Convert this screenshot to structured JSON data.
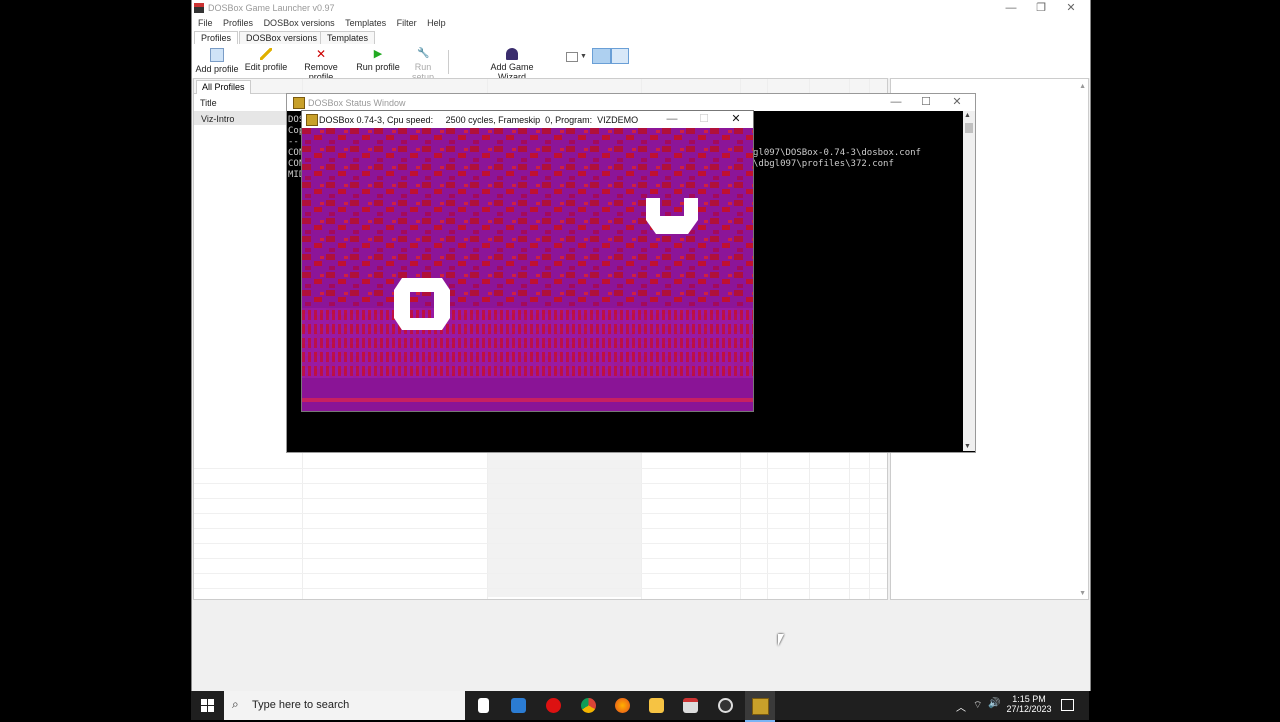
{
  "launcher": {
    "title": "DOSBox Game Launcher v0.97",
    "menu": [
      "File",
      "Profiles",
      "DOSBox versions",
      "Templates",
      "Filter",
      "Help"
    ],
    "tabs": [
      "Profiles",
      "DOSBox versions",
      "Templates"
    ],
    "toolbar": {
      "add_profile": "Add profile",
      "edit_profile": "Edit profile",
      "remove_profile": "Remove profile",
      "run_profile": "Run profile",
      "run_setup": "Run setup",
      "add_game_wizard": "Add Game Wizard"
    },
    "filter_tab": "All Profiles",
    "table": {
      "column_title": "Title",
      "rows": [
        "Viz-Intro"
      ]
    }
  },
  "status_window": {
    "title": "DOSBox Status Window",
    "lines_left": [
      "DOS",
      "Cop",
      "--",
      "CON",
      "CON",
      "MID"
    ],
    "line_conf1": "gl097\\DOSBox-0.74-3\\dosbox.conf",
    "line_conf2": "\\dbgl097\\profiles\\372.conf"
  },
  "game_window": {
    "title": "DOSBox 0.74-3, Cpu speed:     2500 cycles, Frameskip  0, Program:  VIZDEMO"
  },
  "taskbar": {
    "search_placeholder": "Type here to search",
    "time": "1:15 PM",
    "date": "27/12/2023"
  },
  "colors": {
    "screen_magenta": "#8a1496",
    "screen_red": "#c0102a",
    "taskbar": "#1f1f1f"
  }
}
